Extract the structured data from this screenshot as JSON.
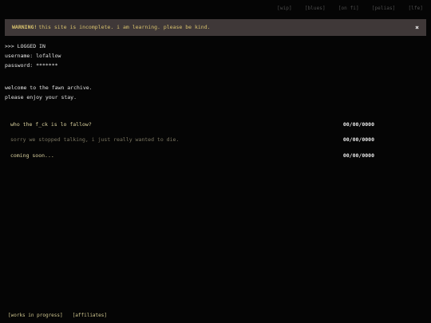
{
  "nav": {
    "items": [
      "[wip]",
      "[blues]",
      "[on fi]",
      "[pelias]",
      "[lfe]"
    ]
  },
  "warning": {
    "title": "WARNING!",
    "message": "this site is incomplete. i am learning. please be kind.",
    "close_label": "×"
  },
  "login": {
    "status": ">>> LOGGED IN",
    "username_line": "username: lofallow",
    "password_line": "password: *******"
  },
  "welcome": {
    "line1": "welcome to the fawn archive.",
    "line2": "please enjoy your stay."
  },
  "posts": [
    {
      "title": "who the f_ck is lo fallow?",
      "date": "00/00/0000"
    },
    {
      "title": "sorry we stopped talking, i just really wanted to die.",
      "date": "00/00/0000"
    },
    {
      "title": "coming soon...",
      "date": "00/00/0000"
    }
  ],
  "footer": {
    "link1": "[works in progress]",
    "link2": "[affiliates]"
  },
  "colors": {
    "background": "#050505",
    "warning_bg": "#3f3838",
    "warning_text": "#d8c26e",
    "accent_text": "#dcd3a0"
  }
}
